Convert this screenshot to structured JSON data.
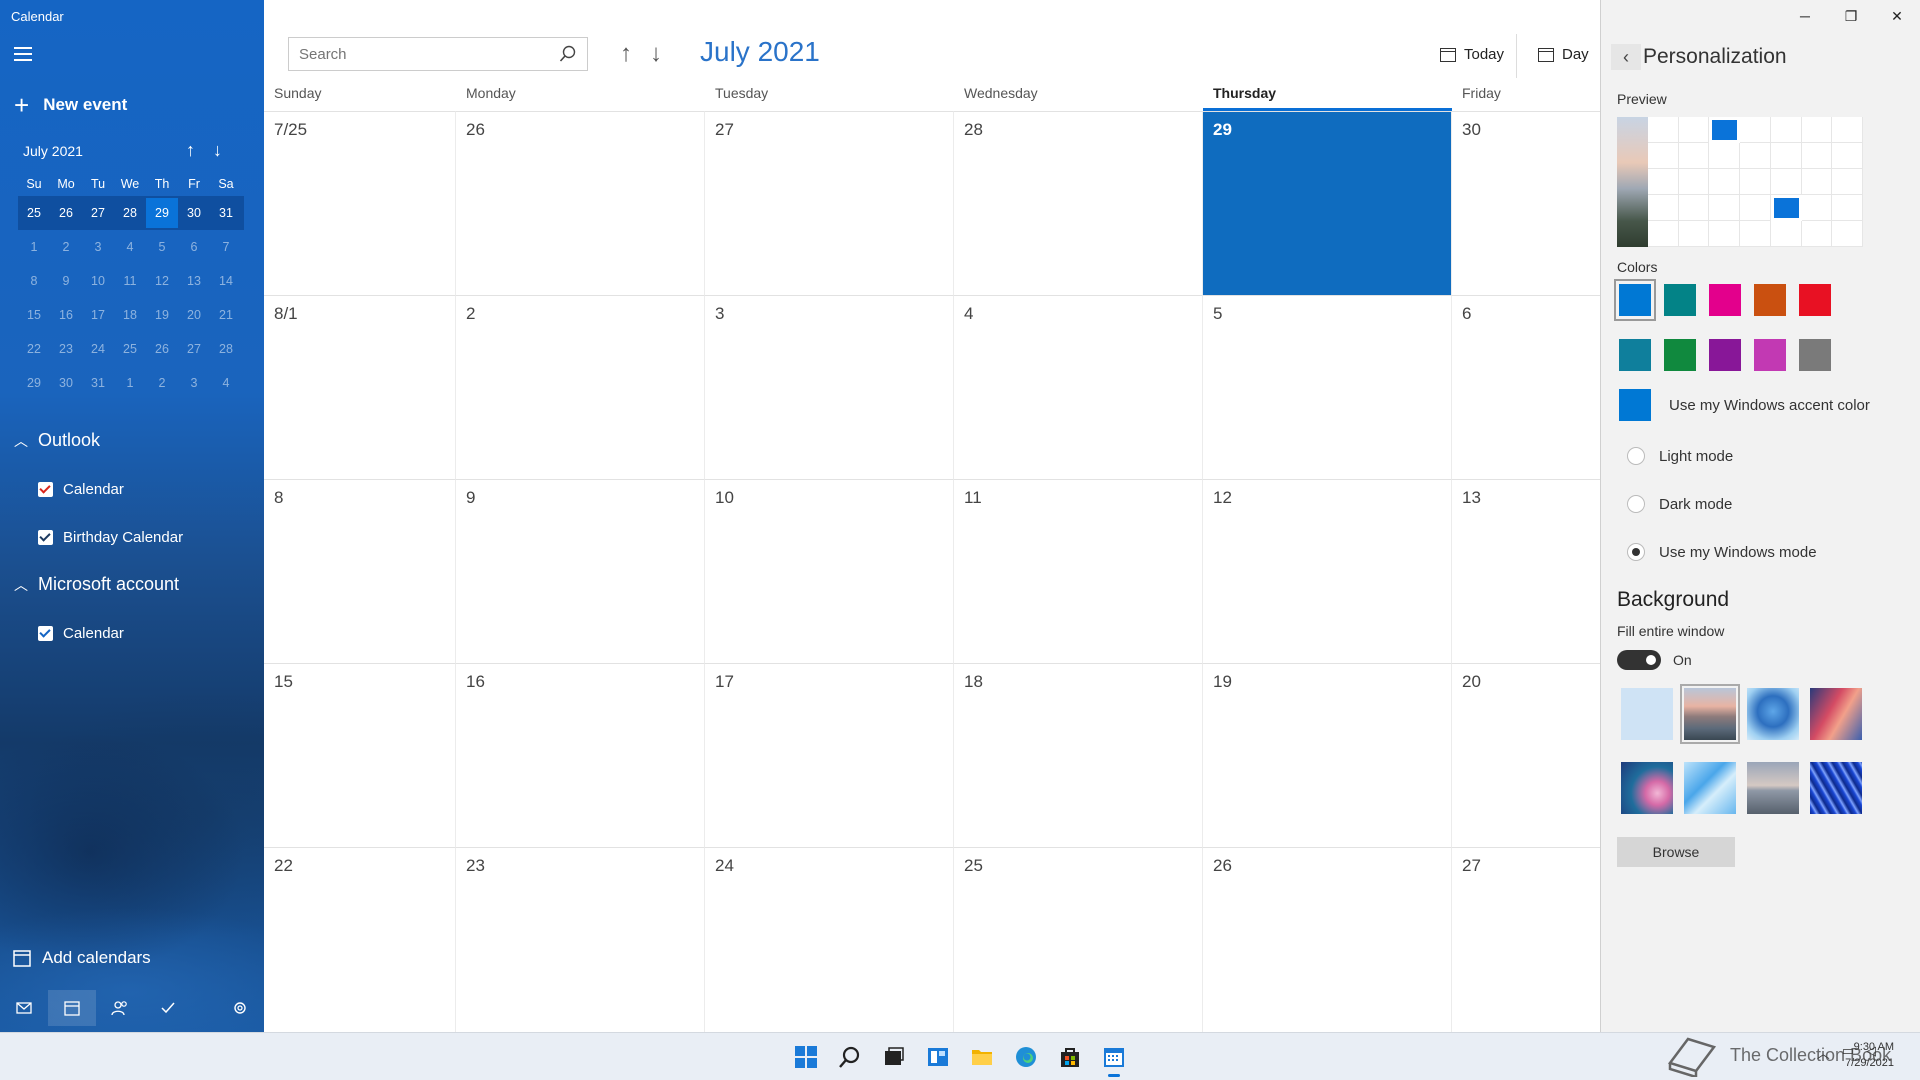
{
  "app": {
    "title": "Calendar"
  },
  "sidebar": {
    "new_event": "New event",
    "mini_calendar": {
      "month_label": "July 2021",
      "weekdays": [
        "Su",
        "Mo",
        "Tu",
        "We",
        "Th",
        "Fr",
        "Sa"
      ],
      "weeks": [
        [
          "25",
          "26",
          "27",
          "28",
          "29",
          "30",
          "31"
        ],
        [
          "1",
          "2",
          "3",
          "4",
          "5",
          "6",
          "7"
        ],
        [
          "8",
          "9",
          "10",
          "11",
          "12",
          "13",
          "14"
        ],
        [
          "15",
          "16",
          "17",
          "18",
          "19",
          "20",
          "21"
        ],
        [
          "22",
          "23",
          "24",
          "25",
          "26",
          "27",
          "28"
        ],
        [
          "29",
          "30",
          "31",
          "1",
          "2",
          "3",
          "4"
        ]
      ],
      "today": "29"
    },
    "accounts": [
      {
        "name": "Outlook",
        "calendars": [
          {
            "label": "Calendar",
            "checked": true,
            "color": "#d9261c"
          },
          {
            "label": "Birthday Calendar",
            "checked": true,
            "color": "#1d3a5f"
          }
        ]
      },
      {
        "name": "Microsoft account",
        "calendars": [
          {
            "label": "Calendar",
            "checked": true,
            "color": "#1565c4"
          }
        ]
      }
    ],
    "add_calendars": "Add calendars"
  },
  "main": {
    "search_placeholder": "Search",
    "month_title": "July 2021",
    "today_label": "Today",
    "day_label": "Day",
    "weekdays": [
      "Sunday",
      "Monday",
      "Tuesday",
      "Wednesday",
      "Thursday",
      "Friday"
    ],
    "active_weekday": "Thursday",
    "weeks": [
      [
        "7/25",
        "26",
        "27",
        "28",
        "29",
        "30"
      ],
      [
        "8/1",
        "2",
        "3",
        "4",
        "5",
        "6"
      ],
      [
        "8",
        "9",
        "10",
        "11",
        "12",
        "13"
      ],
      [
        "15",
        "16",
        "17",
        "18",
        "19",
        "20"
      ],
      [
        "22",
        "23",
        "24",
        "25",
        "26",
        "27"
      ]
    ],
    "today": "29"
  },
  "panel": {
    "title": "Personalization",
    "preview_label": "Preview",
    "colors_label": "Colors",
    "colors_row1": [
      "#0078d4",
      "#038387",
      "#e3008c",
      "#ca5010",
      "#e81123"
    ],
    "colors_row2": [
      "#0f7f9c",
      "#10893e",
      "#881798",
      "#c239b3",
      "#7a7a7a"
    ],
    "accent_color": "#0078d4",
    "accent_label": "Use my Windows accent color",
    "light_mode": "Light mode",
    "dark_mode": "Dark mode",
    "windows_mode": "Use my Windows mode",
    "background_title": "Background",
    "fill_label": "Fill entire window",
    "toggle_state": "On",
    "browse_label": "Browse"
  },
  "taskbar": {
    "time": "9:30 AM",
    "date": "7/29/2021"
  },
  "watermark": "The Collection Book"
}
